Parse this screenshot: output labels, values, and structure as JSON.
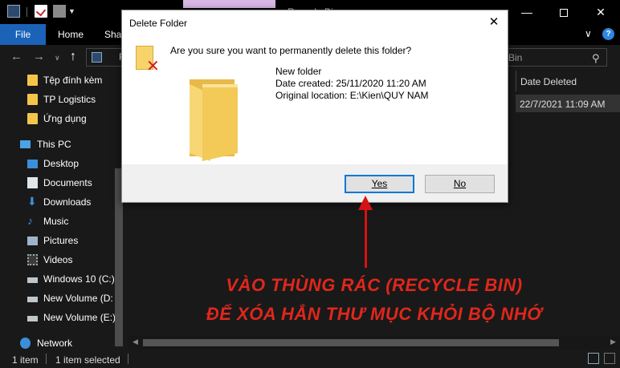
{
  "window": {
    "title": "Recycle Bin",
    "controls": {
      "minimize": "—",
      "maximize": "",
      "close": "✕"
    }
  },
  "ribbon": {
    "tabs": [
      "File",
      "Home",
      "Shar"
    ],
    "expand": "∨",
    "help": "?"
  },
  "address": {
    "location_partial": "R",
    "search_placeholder": "e Bin"
  },
  "sidebar": {
    "items": [
      {
        "label": "Tệp đính kèm",
        "icon": "folder-icon"
      },
      {
        "label": "TP Logistics",
        "icon": "folder-icon"
      },
      {
        "label": "Ứng dụng",
        "icon": "folder-icon"
      },
      {
        "label": "This PC",
        "icon": "pc-icon"
      },
      {
        "label": "Desktop",
        "icon": "desktop-icon"
      },
      {
        "label": "Documents",
        "icon": "documents-icon"
      },
      {
        "label": "Downloads",
        "icon": "downloads-icon"
      },
      {
        "label": "Music",
        "icon": "music-icon"
      },
      {
        "label": "Pictures",
        "icon": "pictures-icon"
      },
      {
        "label": "Videos",
        "icon": "videos-icon"
      },
      {
        "label": "Windows 10 (C:)",
        "icon": "drive-icon"
      },
      {
        "label": "New Volume (D:",
        "icon": "drive-icon"
      },
      {
        "label": "New Volume (E:)",
        "icon": "drive-icon"
      },
      {
        "label": "Network",
        "icon": "network-icon"
      }
    ]
  },
  "content": {
    "column_header": "Date Deleted",
    "row_date_deleted": "22/7/2021 11:09 AM"
  },
  "status": {
    "item_count": "1 item",
    "selected": "1 item selected"
  },
  "dialog": {
    "title": "Delete Folder",
    "close": "✕",
    "question": "Are you sure you want to permanently delete this folder?",
    "folder_name": "New folder",
    "date_created": "Date created: 25/11/2020 11:20 AM",
    "original_location": "Original location: E:\\Kien\\QUY NAM",
    "yes_label": "Yes",
    "no_label": "No"
  },
  "annotation": {
    "line1": "VÀO THÙNG RÁC (RECYCLE BIN)",
    "line2": "ĐỂ XÓA HẲN THƯ MỤC KHỎI BỘ NHỚ",
    "color": "#e0271c"
  }
}
